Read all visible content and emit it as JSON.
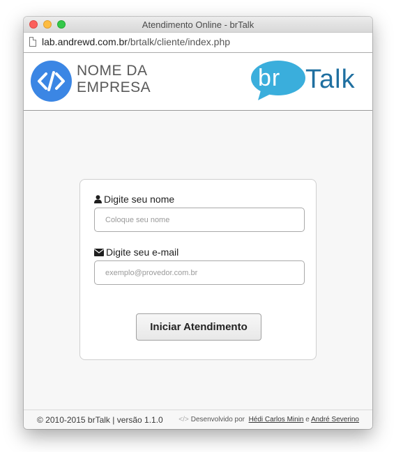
{
  "window": {
    "title": "Atendimento Online - brTalk"
  },
  "urlbar": {
    "host": "lab.andrewd.com.br",
    "path": "/brtalk/cliente/index.php"
  },
  "header": {
    "company_line1": "NOME DA",
    "company_line2": "EMPRESA",
    "brand_bubble": "br",
    "brand_word": "Talk"
  },
  "colors": {
    "logo_blue": "#3b86e4",
    "brand_light_blue": "#3aaedc",
    "brand_dark_blue": "#1f6fa0"
  },
  "form": {
    "name_label": "Digite seu nome",
    "name_placeholder": "Coloque seu nome",
    "email_label": "Digite seu e-mail",
    "email_placeholder": "exemplo@provedor.com.br",
    "submit_label": "Iniciar Atendimento"
  },
  "footer": {
    "copyright": "© 2010-2015 brTalk | versão 1.1.0",
    "dev_prefix": "Desenvolvido por",
    "dev_code_glyph": "</>",
    "dev1": "Hédi Carlos Minin",
    "dev_conj": "e",
    "dev2": "André Severino"
  },
  "icons": {
    "name_label_icon": "user-icon",
    "email_label_icon": "envelope-icon",
    "company_logo_icon": "code-icon",
    "url_icon": "page-icon"
  }
}
